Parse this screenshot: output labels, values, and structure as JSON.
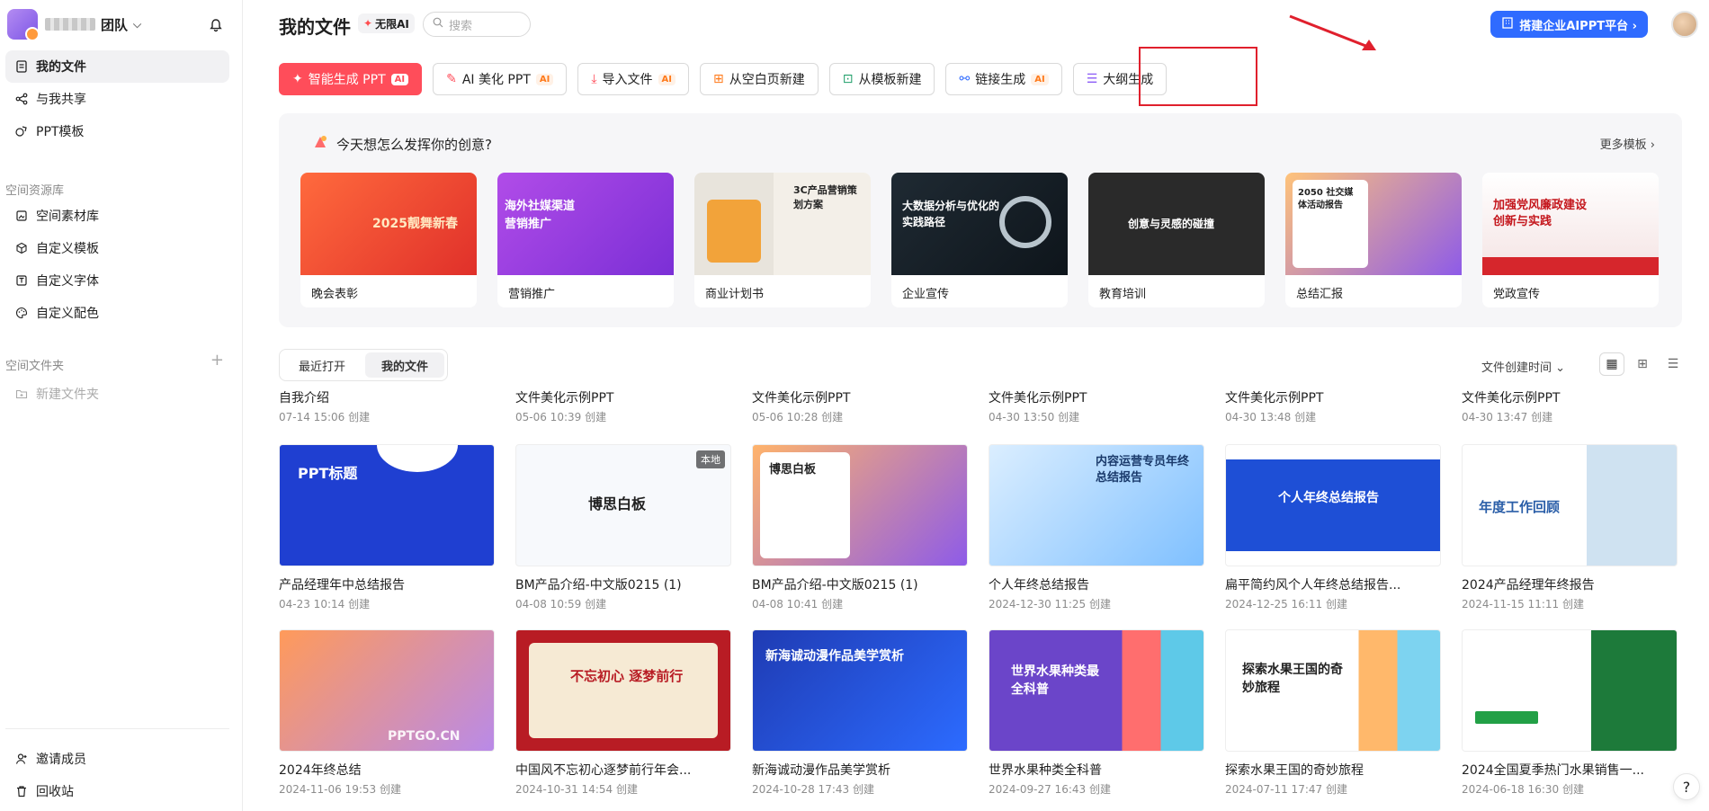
{
  "sidebar": {
    "team_suffix": "团队",
    "nav": [
      {
        "label": "我的文件",
        "icon": "document-icon"
      },
      {
        "label": "与我共享",
        "icon": "share-icon"
      },
      {
        "label": "PPT模板",
        "icon": "template-icon"
      }
    ],
    "space_resources_title": "空间资源库",
    "resources": [
      {
        "label": "空间素材库",
        "icon": "material-icon"
      },
      {
        "label": "自定义模板",
        "icon": "cube-icon"
      },
      {
        "label": "自定义字体",
        "icon": "font-icon"
      },
      {
        "label": "自定义配色",
        "icon": "palette-icon"
      }
    ],
    "space_folders_title": "空间文件夹",
    "new_folder": "新建文件夹",
    "bottom": [
      {
        "label": "邀请成员",
        "icon": "invite-icon"
      },
      {
        "label": "回收站",
        "icon": "trash-icon"
      }
    ]
  },
  "header": {
    "title": "我的文件",
    "unlimited_label": "无限AI",
    "search_placeholder": "搜索",
    "enterprise_button": "搭建企业AIPPT平台 ›"
  },
  "actions": [
    {
      "label": "智能生成 PPT",
      "ai": "AI",
      "primary": true
    },
    {
      "label": "AI 美化 PPT",
      "ai": "AI"
    },
    {
      "label": "导入文件",
      "ai": "AI"
    },
    {
      "label": "从空白页新建",
      "ai": ""
    },
    {
      "label": "从模板新建",
      "ai": ""
    },
    {
      "label": "链接生成",
      "ai": "AI"
    },
    {
      "label": "大纲生成",
      "ai": ""
    }
  ],
  "inspire": {
    "title": "今天想怎么发挥你的创意?",
    "more": "更多模板 ›",
    "templates": [
      {
        "label": "晚会表彰",
        "img_text": "2025靓舞新春"
      },
      {
        "label": "营销推广",
        "img_text": "海外社媒渠道营销推广"
      },
      {
        "label": "商业计划书",
        "img_text": "3C产品营销策划方案"
      },
      {
        "label": "企业宣传",
        "img_text": "大数据分析与优化的实践路径"
      },
      {
        "label": "教育培训",
        "img_text": "创意与灵感的碰撞"
      },
      {
        "label": "总结汇报",
        "img_text": "2050 社交媒体活动报告"
      },
      {
        "label": "党政宣传",
        "img_text": "加强党风廉政建设创新与实践"
      }
    ]
  },
  "tabs": {
    "recent": "最近打开",
    "mine": "我的文件"
  },
  "sort_label": "文件创建时间 ⌄",
  "files_row1": [
    {
      "name": "自我介绍",
      "meta": "07-14 15:06 创建"
    },
    {
      "name": "文件美化示例PPT",
      "meta": "05-06 10:39 创建"
    },
    {
      "name": "文件美化示例PPT",
      "meta": "05-06 10:28 创建"
    },
    {
      "name": "文件美化示例PPT",
      "meta": "04-30 13:50 创建"
    },
    {
      "name": "文件美化示例PPT",
      "meta": "04-30 13:48 创建"
    },
    {
      "name": "文件美化示例PPT",
      "meta": "04-30 13:47 创建"
    }
  ],
  "files_row2": [
    {
      "name": "产品经理年中总结报告",
      "meta": "04-23 10:14 创建",
      "thumb": "PPT标题"
    },
    {
      "name": "BM产品介绍-中文版0215 (1)",
      "meta": "04-08 10:59 创建",
      "thumb": "博思白板",
      "badge": "本地"
    },
    {
      "name": "BM产品介绍-中文版0215 (1)",
      "meta": "04-08 10:41 创建",
      "thumb": "博思白板"
    },
    {
      "name": "个人年终总结报告",
      "meta": "2024-12-30 11:25 创建",
      "thumb": "内容运营专员年终总结报告"
    },
    {
      "name": "扁平简约风个人年终总结报告...",
      "meta": "2024-12-25 16:11 创建",
      "thumb": "个人年终总结报告"
    },
    {
      "name": "2024产品经理年终报告",
      "meta": "2024-11-15 11:11 创建",
      "thumb": "年度工作回顾"
    }
  ],
  "files_row3": [
    {
      "name": "2024年终总结",
      "meta": "2024-11-06 19:53 创建",
      "thumb": "PPTGO.CN"
    },
    {
      "name": "中国风不忘初心逐梦前行年会...",
      "meta": "2024-10-31 14:54 创建",
      "thumb": "不忘初心 逐梦前行"
    },
    {
      "name": "新海诚动漫作品美学赏析",
      "meta": "2024-10-28 17:43 创建",
      "thumb": "新海诚动漫作品美学赏析"
    },
    {
      "name": "世界水果种类全科普",
      "meta": "2024-09-27 16:43 创建",
      "thumb": "世界水果种类最全科普"
    },
    {
      "name": "探索水果王国的奇妙旅程",
      "meta": "2024-07-11 17:47 创建",
      "thumb": "探索水果王国的奇妙旅程"
    },
    {
      "name": "2024全国夏季热门水果销售一...",
      "meta": "2024-06-18 16:30 创建",
      "thumb": ""
    }
  ]
}
